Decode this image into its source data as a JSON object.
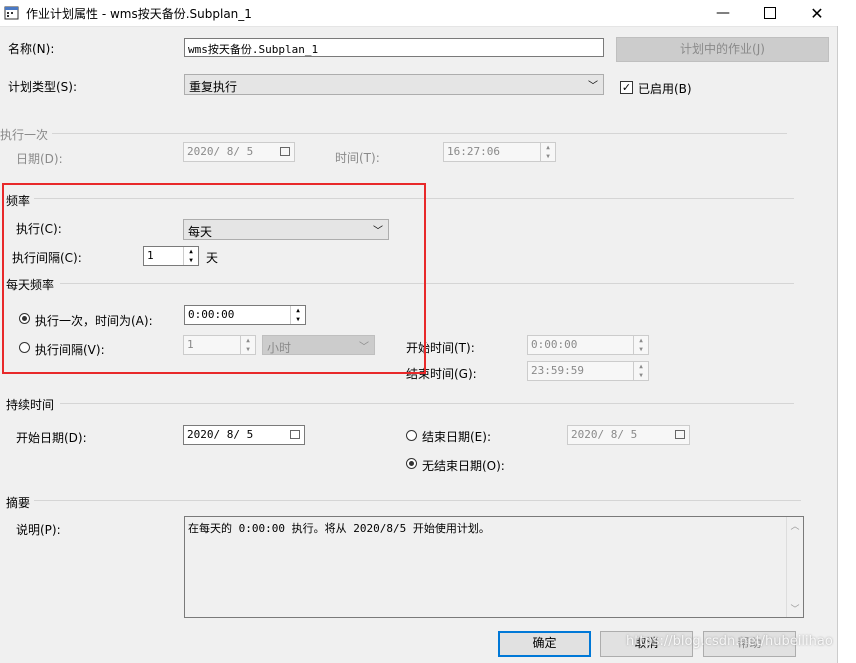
{
  "window": {
    "title": "作业计划属性 - wms按天备份.Subplan_1",
    "min_icon": "minimize-icon",
    "max_icon": "maximize-icon",
    "close_icon": "close-icon"
  },
  "general": {
    "name_label": "名称(N):",
    "name_value": "wms按天备份.Subplan_1",
    "jobs_button": "计划中的作业(J)",
    "type_label": "计划类型(S):",
    "type_value": "重复执行",
    "enabled_label": "已启用(B)",
    "enabled": true
  },
  "once": {
    "section": "执行一次",
    "date_label": "日期(D):",
    "date_value": "2020/ 8/ 5",
    "time_label": "时间(T):",
    "time_value": "16:27:06"
  },
  "frequency": {
    "section": "频率",
    "occurs_label": "执行(C):",
    "occurs_value": "每天",
    "interval_label": "执行间隔(C):",
    "interval_value": "1",
    "interval_unit": "天"
  },
  "daily": {
    "section": "每天频率",
    "once_label": "执行一次，时间为(A):",
    "once_value": "0:00:00",
    "once_selected": true,
    "every_label": "执行间隔(V):",
    "every_value": "1",
    "every_unit": "小时",
    "start_label": "开始时间(T):",
    "start_value": "0:00:00",
    "end_label": "结束时间(G):",
    "end_value": "23:59:59"
  },
  "duration": {
    "section": "持续时间",
    "start_label": "开始日期(D):",
    "start_value": "2020/ 8/ 5",
    "end_label": "结束日期(E):",
    "end_value": "2020/ 8/ 5",
    "no_end_label": "无结束日期(O):",
    "no_end_selected": true
  },
  "summary": {
    "section": "摘要",
    "desc_label": "说明(P):",
    "desc_value": "在每天的 0:00:00 执行。将从 2020/8/5 开始使用计划。"
  },
  "footer": {
    "ok": "确定",
    "cancel": "取消",
    "help": "帮助",
    "watermark": "https://blog.csdn.net/hubeilihao"
  },
  "highlight_color": "#e8292a"
}
